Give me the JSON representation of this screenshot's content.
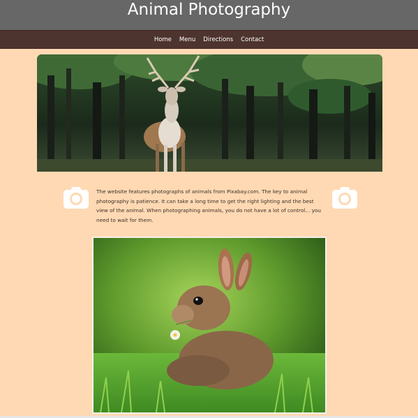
{
  "header": {
    "title": "Animal Photography",
    "background_color": "#676767"
  },
  "nav": {
    "items": [
      {
        "label": "Home"
      },
      {
        "label": "Menu"
      },
      {
        "label": "Directions"
      },
      {
        "label": "Contact"
      }
    ],
    "background_color": "#4E342E"
  },
  "hero": {
    "image": "deer-in-forest"
  },
  "intro": {
    "text": "The website features photographs of animals from Pixabay.com. The key to animal photography is patience. It can take a long time to get the right lighting and the best view of the animal. When photographing animals, you do not have a lot of control... you need to wait for them."
  },
  "icons": {
    "left": "camera-icon",
    "right": "camera-icon"
  },
  "feature_image": {
    "image": "rabbit-in-grass"
  },
  "page": {
    "background_color": "#FFD9B3"
  }
}
